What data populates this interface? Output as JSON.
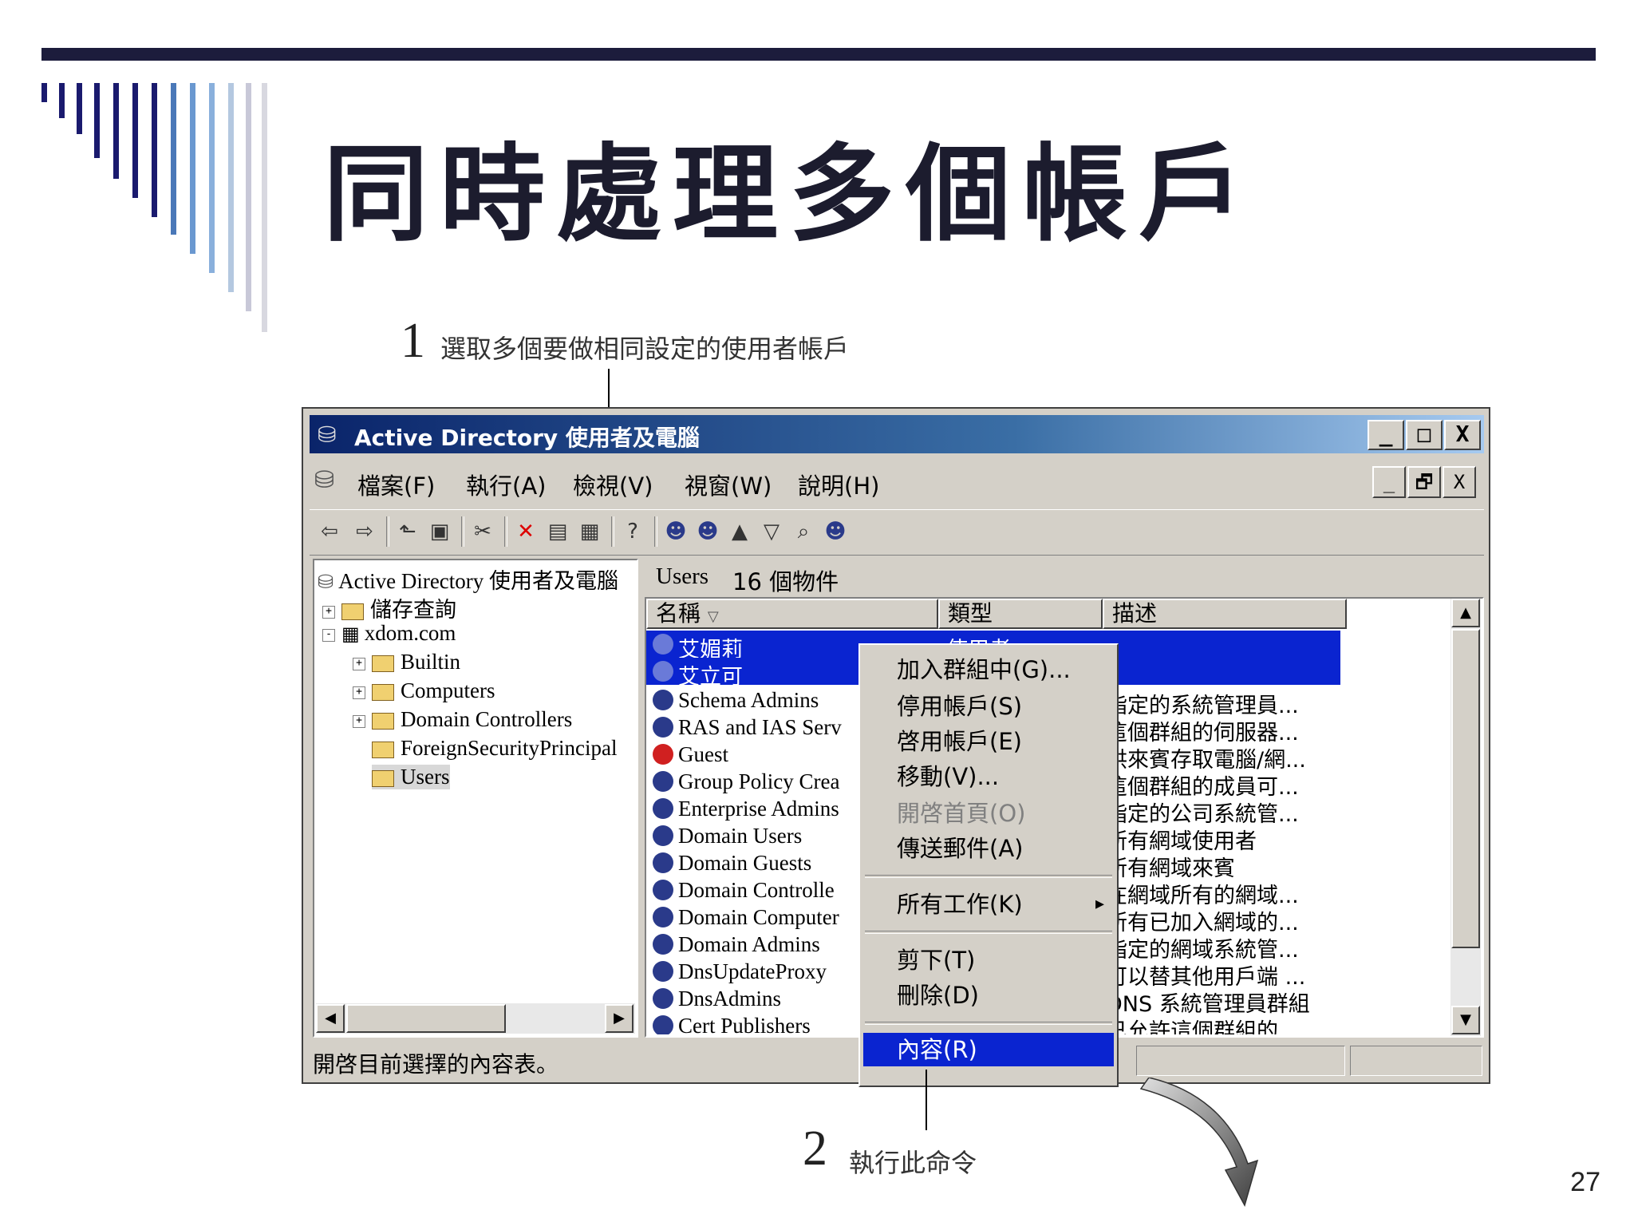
{
  "slide": {
    "title": "同時處理多個帳戶",
    "page_number": "27",
    "step1": {
      "num": "1",
      "text": "選取多個要做相同設定的使用者帳戶"
    },
    "step2": {
      "num": "2",
      "text": "執行此命令"
    },
    "colors": {
      "title": "#1c1c2e",
      "bar": "#1c1c3c",
      "deco_dark": "#1a1a6e",
      "deco_mid": "#6a98d0",
      "deco_light": "#c8c8d8"
    }
  },
  "window": {
    "title": "Active Directory 使用者及電腦",
    "caption_buttons": [
      "_",
      "□",
      "X"
    ],
    "child_buttons": [
      "_",
      "🗗",
      "X"
    ],
    "menu": [
      "檔案(F)",
      "執行(A)",
      "檢視(V)",
      "視窗(W)",
      "說明(H)"
    ],
    "toolbar_icons": [
      "back-icon",
      "forward-icon",
      "up-folder-icon",
      "show-tree-icon",
      "cut-icon",
      "delete-icon",
      "properties-icon",
      "export-icon",
      "help-icon",
      "new-user-icon",
      "new-group-icon",
      "new-ou-icon",
      "filter-icon",
      "find-icon",
      "add-member-icon"
    ],
    "toolbar_glyphs": [
      "⇦",
      "⇨",
      "⬑",
      "▣",
      "✂",
      "✕",
      "▤",
      "▦",
      "?",
      "☻",
      "☻",
      "▲",
      "▽",
      "⌕",
      "☻"
    ]
  },
  "tree": {
    "root": "Active Directory 使用者及電腦",
    "items": [
      {
        "label": "儲存查詢",
        "expander": "+"
      },
      {
        "label": "xdom.com",
        "expander": "-"
      },
      {
        "label": "Builtin",
        "expander": "+"
      },
      {
        "label": "Computers",
        "expander": "+"
      },
      {
        "label": "Domain Controllers",
        "expander": "+"
      },
      {
        "label": "ForeignSecurityPrincipal",
        "expander": ""
      },
      {
        "label": "Users",
        "expander": ""
      }
    ]
  },
  "list": {
    "header_folder": "Users",
    "header_count": "16 個物件",
    "columns": [
      "名稱",
      "類型",
      "描述"
    ],
    "rows": [
      {
        "name": "艾媚莉",
        "type": "使用者",
        "desc": ""
      },
      {
        "name": "艾立可",
        "type": "",
        "desc": ""
      },
      {
        "name": "Schema Admins",
        "type": "",
        "desc": "指定的系統管理員..."
      },
      {
        "name": "RAS and IAS Serv",
        "type": "",
        "desc": "這個群組的伺服器..."
      },
      {
        "name": "Guest",
        "type": "",
        "desc": "供來賓存取電腦/網..."
      },
      {
        "name": "Group Policy Crea",
        "type": "",
        "desc": "這個群組的成員可..."
      },
      {
        "name": "Enterprise Admins",
        "type": "",
        "desc": "指定的公司系統管..."
      },
      {
        "name": "Domain Users",
        "type": "",
        "desc": "所有網域使用者"
      },
      {
        "name": "Domain Guests",
        "type": "",
        "desc": "所有網域來賓"
      },
      {
        "name": "Domain Controlle",
        "type": "",
        "desc": "在網域所有的網域..."
      },
      {
        "name": "Domain Computer",
        "type": "",
        "desc": "所有已加入網域的..."
      },
      {
        "name": "Domain Admins",
        "type": "",
        "desc": "指定的網域系統管..."
      },
      {
        "name": "DnsUpdateProxy",
        "type": "",
        "desc": "可以替其他用戶端 ..."
      },
      {
        "name": "DnsAdmins",
        "type": "",
        "desc": "DNS 系統管理員群組"
      },
      {
        "name": "Cert Publishers",
        "type": "",
        "desc": "已允許這個群組的..."
      }
    ]
  },
  "status_text": "開啓目前選擇的內容表。",
  "context_menu": {
    "items": [
      {
        "label": "加入群組中(G)...",
        "state": "normal"
      },
      {
        "label": "停用帳戶(S)",
        "state": "normal"
      },
      {
        "label": "啓用帳戶(E)",
        "state": "normal"
      },
      {
        "label": "移動(V)...",
        "state": "normal"
      },
      {
        "label": "開啓首頁(O)",
        "state": "disabled"
      },
      {
        "label": "傳送郵件(A)",
        "state": "normal"
      },
      {
        "label": "所有工作(K)",
        "state": "submenu"
      },
      {
        "label": "剪下(T)",
        "state": "normal"
      },
      {
        "label": "刪除(D)",
        "state": "normal"
      },
      {
        "label": "內容(R)",
        "state": "active"
      }
    ],
    "submenu_arrow": "▸"
  }
}
